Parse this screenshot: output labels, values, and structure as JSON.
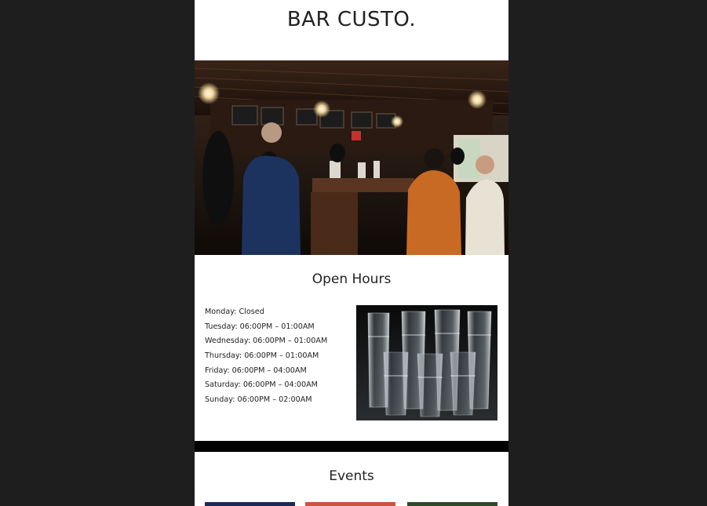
{
  "brand": {
    "logo": "BAR CUSTO."
  },
  "open_hours": {
    "title": "Open Hours",
    "days": [
      "Monday: Closed",
      "Tuesday: 06:00PM – 01:00AM",
      "Wednesday: 06:00PM – 01:00AM",
      "Thursday: 06:00PM – 01:00AM",
      "Friday: 06:00PM – 04:00AM",
      "Saturday: 06:00PM – 04:00AM",
      "Sunday: 06:00PM – 02:00AM"
    ]
  },
  "events": {
    "title": "Events"
  },
  "colors": {
    "background": "#1e1e1e",
    "page": "#ffffff",
    "text": "#222222",
    "band": "#000000"
  },
  "images": {
    "hero": "bar-interior-photo",
    "hours": "stacked-glasses-photo",
    "events": [
      "event-photo-blue",
      "event-photo-red",
      "event-photo-green"
    ]
  }
}
